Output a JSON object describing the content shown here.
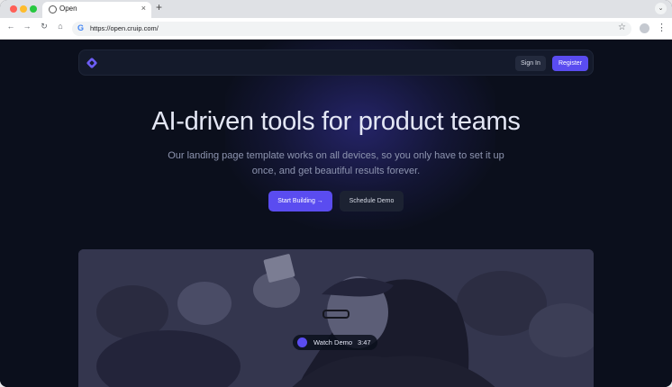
{
  "browser": {
    "tab_title": "Open",
    "tab_close": "×",
    "new_tab": "+",
    "tab_menu": "⌄",
    "back": "←",
    "forward": "→",
    "reload": "↻",
    "home": "⌂",
    "search_engine_glyph": "G",
    "url": "https://open.cruip.com/",
    "bookmark": "☆",
    "menu": "⋮"
  },
  "site": {
    "nav": {
      "signin_label": "Sign In",
      "register_label": "Register"
    },
    "hero": {
      "title": "AI-driven tools for product teams",
      "subtitle": "Our landing page template works on all devices, so you only have to set it up once, and get beautiful results forever.",
      "primary_cta": "Start Building →",
      "secondary_cta": "Schedule Demo"
    },
    "video": {
      "watch_label": "Watch Demo",
      "separator": "-",
      "duration": "3:47"
    }
  },
  "colors": {
    "accent": "#5a4cf0",
    "page_bg": "#0b0f1c"
  }
}
